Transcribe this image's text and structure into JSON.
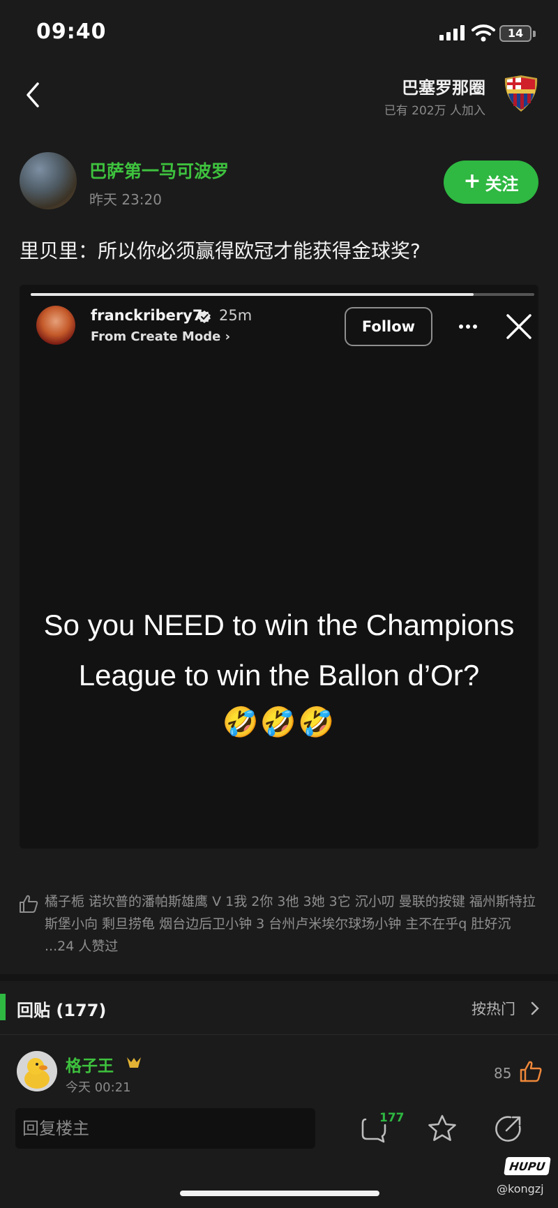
{
  "status_bar": {
    "time": "09:40",
    "battery": "14"
  },
  "header": {
    "circle_name": "巴塞罗那圈",
    "circle_members": "已有 202万 人加入"
  },
  "post": {
    "author": "巴萨第一马可波罗",
    "time": "昨天 23:20",
    "follow_label": "关注",
    "text": "里贝里：所以你必须赢得欧冠才能获得金球奖?"
  },
  "story": {
    "username": "franckribery7",
    "age": "25m",
    "mode": "From Create Mode",
    "follow_label": "Follow",
    "progress": 0.88,
    "text_line1": "So you NEED to win the Champions",
    "text_line2": "League to win the Ballon d’Or?",
    "emoji": "🤣🤣🤣"
  },
  "likes": {
    "text": "橘子栀 诺坎普的潘帕斯雄鹰 V 1我 2你 3他 3她 3它 沉小叨 曼联的按键 福州斯特拉斯堡小向 剩旦捞龟 烟台边后卫小钟 3 台州卢米埃尔球场小钟 主不在乎q 肚好沉 ...24 人赞过"
  },
  "replies": {
    "title": "回贴 (177)",
    "sort": "按热门",
    "items": [
      {
        "user": "格子王",
        "time": "今天 00:21",
        "likes": "85"
      }
    ]
  },
  "bottom_bar": {
    "reply_placeholder": "回复楼主",
    "comment_count": "177"
  },
  "watermark": {
    "logo": "HUPU",
    "handle": "@kongzj"
  },
  "colors": {
    "accent_green": "#2fb842",
    "background": "#1b1b1b",
    "like_orange": "#f0883a"
  }
}
